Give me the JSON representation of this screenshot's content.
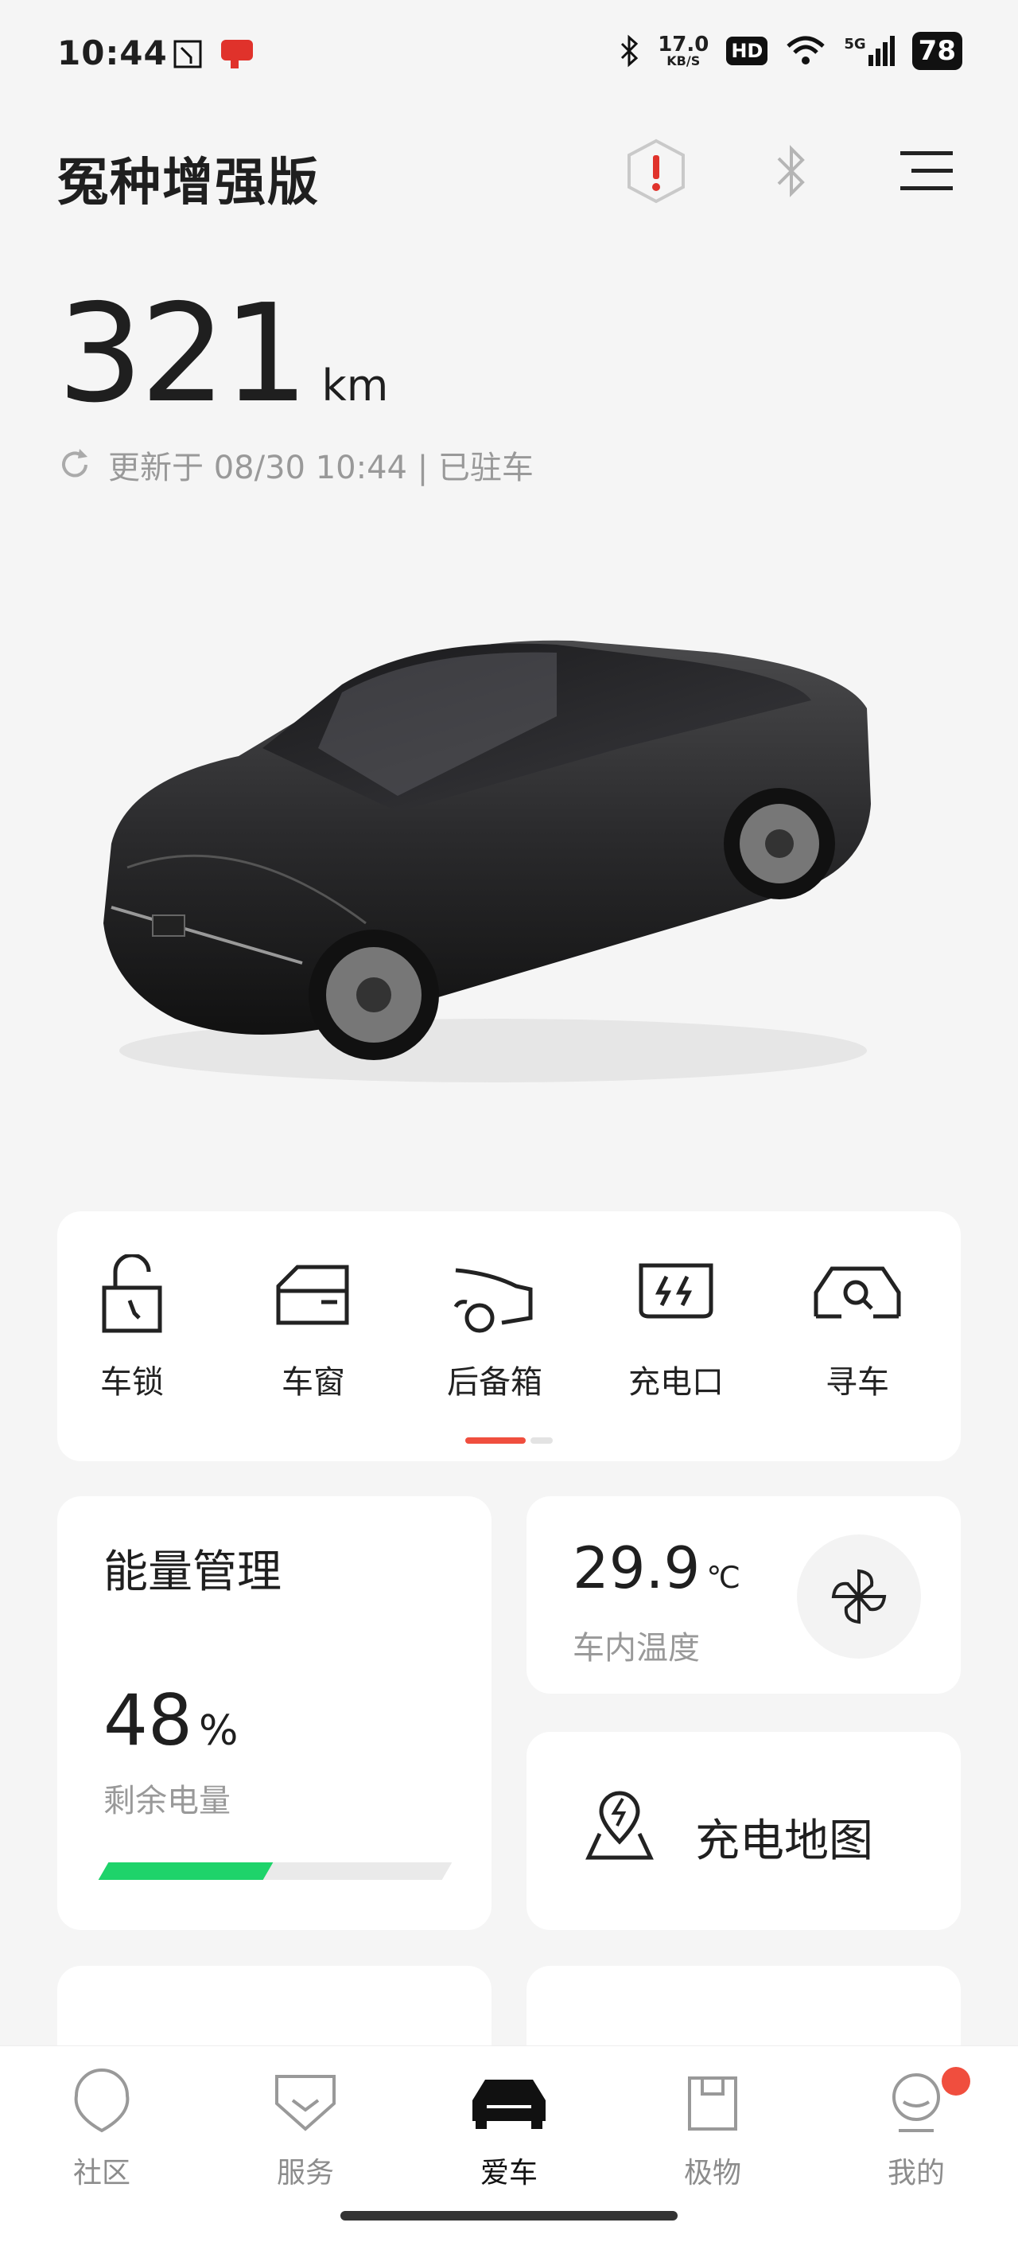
{
  "status_bar": {
    "time": "10:44",
    "speed_value": "17.0",
    "speed_unit": "KB/S",
    "hd": "HD",
    "net": "5G",
    "battery": "78"
  },
  "header": {
    "car_name": "冤种增强版",
    "icons": [
      "alert-icon",
      "bluetooth-icon",
      "menu-icon"
    ]
  },
  "range": {
    "value": "321",
    "unit": "km",
    "updated": "更新于 08/30 10:44 | 已驻车"
  },
  "controls": [
    {
      "label": "车锁",
      "icon": "lock-icon"
    },
    {
      "label": "车窗",
      "icon": "window-icon"
    },
    {
      "label": "后备箱",
      "icon": "trunk-icon"
    },
    {
      "label": "充电口",
      "icon": "charge-port-icon"
    },
    {
      "label": "寻车",
      "icon": "find-car-icon"
    }
  ],
  "energy": {
    "title": "能量管理",
    "percent": "48",
    "percent_unit": "%",
    "subtitle": "剩余电量",
    "level": 0.48,
    "bar_color": "#1ed36a"
  },
  "cabin": {
    "temp": "29.9",
    "unit": "℃",
    "subtitle": "车内温度"
  },
  "charge_map": {
    "label": "充电地图"
  },
  "nav": [
    {
      "label": "社区",
      "active": false
    },
    {
      "label": "服务",
      "active": false
    },
    {
      "label": "爱车",
      "active": true
    },
    {
      "label": "极物",
      "active": false
    },
    {
      "label": "我的",
      "active": false,
      "badge": true
    }
  ],
  "colors": {
    "accent": "#f04e3e",
    "battery_green": "#1ed36a"
  }
}
